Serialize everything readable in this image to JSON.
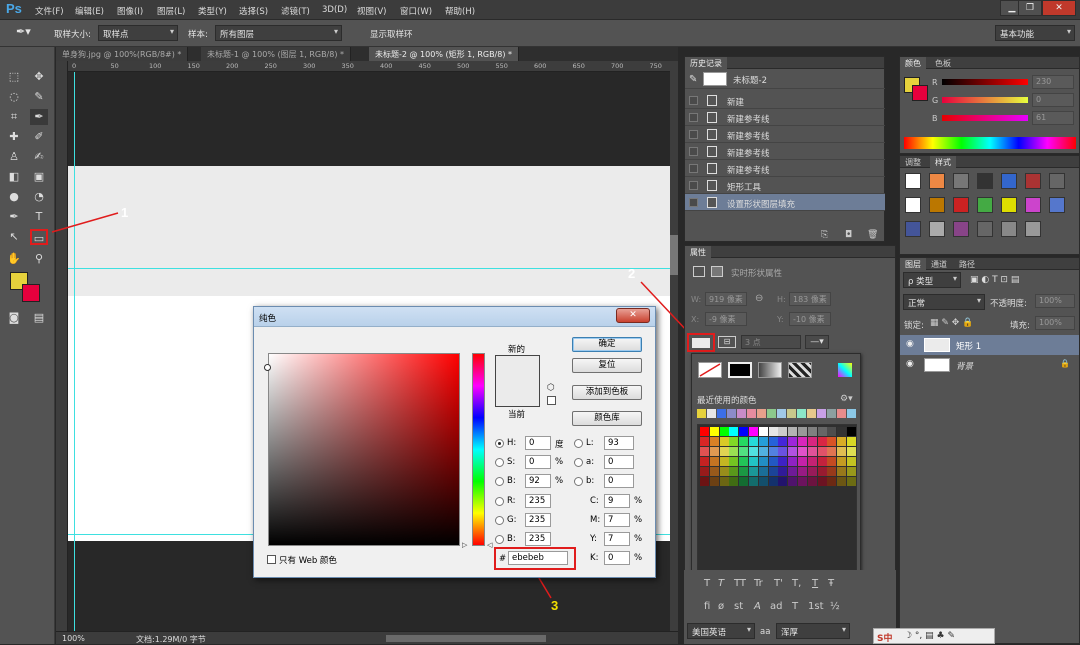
{
  "app": {
    "logo": "Ps"
  },
  "menu": {
    "items": [
      "文件(F)",
      "编辑(E)",
      "图像(I)",
      "图层(L)",
      "类型(Y)",
      "选择(S)",
      "滤镜(T)",
      "3D(D)",
      "视图(V)",
      "窗口(W)",
      "帮助(H)"
    ]
  },
  "window_controls": {
    "minimize": "▁",
    "restore": "❐",
    "close": "✕"
  },
  "options_bar": {
    "sample_size_label": "取样大小:",
    "sample_size_value": "取样点",
    "sample_label": "样本:",
    "sample_value": "所有图层",
    "show_ring_label": "显示取样环",
    "show_ring_checked": true,
    "workspace": "基本功能"
  },
  "tabs": [
    {
      "label": "单身狗.jpg @ 100%(RGB/8#) *",
      "active": false
    },
    {
      "label": "未标题-1 @ 100% (图层 1, RGB/8) *",
      "active": false
    },
    {
      "label": "未标题-2 @ 100% (矩形 1, RGB/8) *",
      "active": true
    }
  ],
  "ruler": {
    "h_ticks": [
      "0",
      "50",
      "100",
      "150",
      "200",
      "250",
      "300",
      "350",
      "400",
      "450",
      "500",
      "550",
      "600",
      "650",
      "700",
      "750"
    ]
  },
  "status": {
    "zoom": "100%",
    "doc": "文档:1.29M/0 字节"
  },
  "history_panel": {
    "title": "历史记录",
    "snapshot": "未标题-2",
    "items": [
      {
        "label": "新建",
        "selected": false
      },
      {
        "label": "新建参考线",
        "selected": false
      },
      {
        "label": "新建参考线",
        "selected": false
      },
      {
        "label": "新建参考线",
        "selected": false
      },
      {
        "label": "新建参考线",
        "selected": false
      },
      {
        "label": "矩形工具",
        "selected": false
      },
      {
        "label": "设置形状图层填充",
        "selected": true
      }
    ]
  },
  "color_panel": {
    "tabs": [
      "颜色",
      "色板"
    ],
    "r_label": "R",
    "g_label": "G",
    "b_label": "B",
    "r": "230",
    "g": "0",
    "b": "61",
    "fg_color": "#e6d23c",
    "bg_color": "#e6003d"
  },
  "styles_panel": {
    "tabs": [
      "调整",
      "样式"
    ]
  },
  "properties_panel": {
    "title": "属性",
    "heading": "实时形状属性",
    "w_label": "W:",
    "w": "919 像素",
    "h_label": "H:",
    "h": "183 像素",
    "x_label": "X:",
    "x": "-9 像素",
    "y_label": "Y:",
    "y": "-10 像素",
    "stroke_width": "3 点"
  },
  "fill_popup": {
    "recent_label": "最近使用的颜色"
  },
  "layers_panel": {
    "tabs": [
      "图层",
      "通道",
      "路径"
    ],
    "kind_label": "ρ 类型",
    "blend_mode": "正常",
    "opacity_label": "不透明度:",
    "opacity": "100%",
    "lock_label": "锁定:",
    "fill_label": "填充:",
    "fill": "100%",
    "layers": [
      {
        "name": "矩形 1",
        "selected": true
      },
      {
        "name": "背景",
        "selected": false
      }
    ]
  },
  "char_panel": {
    "row1": [
      "T",
      "T",
      "TT",
      "Tr",
      "T'",
      "T,",
      "T",
      "Ŧ"
    ],
    "row2": [
      "fi",
      "ø",
      "st",
      "A",
      "ad",
      "T",
      "1st",
      "½"
    ],
    "language": "美国英语",
    "aa_label": "aa",
    "aa_value": "浑厚"
  },
  "ime_bar": {
    "label": "S中"
  },
  "dialog": {
    "title": "纯色",
    "close": "✕",
    "new_label": "新的",
    "current_label": "当前",
    "ok": "确定",
    "reset": "复位",
    "add_to_swatches": "添加到色板",
    "color_libraries": "颜色库",
    "web_only_label": "只有 Web 颜色",
    "fields": {
      "H": {
        "label": "H:",
        "value": "0",
        "unit": "度"
      },
      "S": {
        "label": "S:",
        "value": "0",
        "unit": "%"
      },
      "B": {
        "label": "B:",
        "value": "92",
        "unit": "%"
      },
      "R": {
        "label": "R:",
        "value": "235"
      },
      "G": {
        "label": "G:",
        "value": "235"
      },
      "Bb": {
        "label": "B:",
        "value": "235"
      },
      "L": {
        "label": "L:",
        "value": "93"
      },
      "a": {
        "label": "a:",
        "value": "0"
      },
      "b": {
        "label": "b:",
        "value": "0"
      },
      "C": {
        "label": "C:",
        "value": "9",
        "unit": "%"
      },
      "M": {
        "label": "M:",
        "value": "7",
        "unit": "%"
      },
      "Y": {
        "label": "Y:",
        "value": "7",
        "unit": "%"
      },
      "K": {
        "label": "K:",
        "value": "0",
        "unit": "%"
      }
    },
    "hex_label": "#",
    "hex": "ebebeb",
    "new_color": "#ebebeb",
    "current_color": "#ebebeb"
  },
  "annotations": [
    "1",
    "2",
    "3"
  ],
  "colors": {
    "annotation_red": "#e01c1c",
    "annotation_yellow": "#f2e000",
    "guide": "#3ee0e0"
  }
}
